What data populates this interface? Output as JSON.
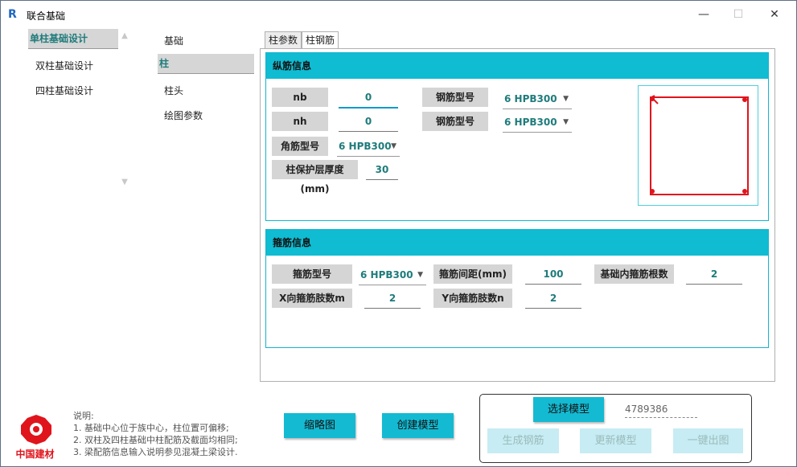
{
  "window": {
    "title": "联合基础",
    "minimize": "—",
    "maximize": "☐",
    "close": "✕",
    "app_icon": "R"
  },
  "left_nav": {
    "items": [
      {
        "label": "单柱基础设计",
        "selected": true
      },
      {
        "label": "双柱基础设计",
        "selected": false
      },
      {
        "label": "四柱基础设计",
        "selected": false
      }
    ]
  },
  "sub_nav": {
    "items": [
      {
        "label": "基础",
        "selected": false
      },
      {
        "label": "柱",
        "selected": true
      },
      {
        "label": "柱头",
        "selected": false
      },
      {
        "label": "绘图参数",
        "selected": false
      }
    ]
  },
  "tabs": [
    {
      "label": "柱参数",
      "active": false
    },
    {
      "label": "柱钢筋",
      "active": true
    }
  ],
  "longitudinal": {
    "title": "纵筋信息",
    "nb_label": "nb",
    "nb_value": "0",
    "nh_label": "nh",
    "nh_value": "0",
    "corner_label": "角筋型号",
    "corner_value": "6 HPB300",
    "bar_type1_label": "钢筋型号",
    "bar_type1_value": "6 HPB300",
    "bar_type2_label": "钢筋型号",
    "bar_type2_value": "6 HPB300",
    "cover_label": "柱保护层厚度(mm)",
    "cover_value": "30"
  },
  "stirrup": {
    "title": "箍筋信息",
    "type_label": "箍筋型号",
    "type_value": "6 HPB300",
    "spacing_label": "箍筋间距(mm)",
    "spacing_value": "100",
    "count_label": "基础内箍筋根数",
    "count_value": "2",
    "xlegs_label": "X向箍筋肢数m",
    "xlegs_value": "2",
    "ylegs_label": "Y向箍筋肢数n",
    "ylegs_value": "2"
  },
  "buttons": {
    "sketch": "缩略图",
    "create_model": "创建模型",
    "select_model": "选择模型",
    "gen_rebar": "生成钢筋",
    "update_model": "更新模型",
    "export": "一键出图"
  },
  "model_id": "4789386",
  "logo": {
    "text": "中国建材"
  },
  "notes": {
    "heading": "说明:",
    "lines": [
      "1. 基础中心位于族中心，柱位置可偏移;",
      "2. 双柱及四柱基础中柱配筋及截面均相同;",
      "3. 梁配筋信息输入说明参见混凝土梁设计."
    ]
  },
  "colors": {
    "accent": "#0fbcd2",
    "rebar_red": "#e0141c"
  }
}
